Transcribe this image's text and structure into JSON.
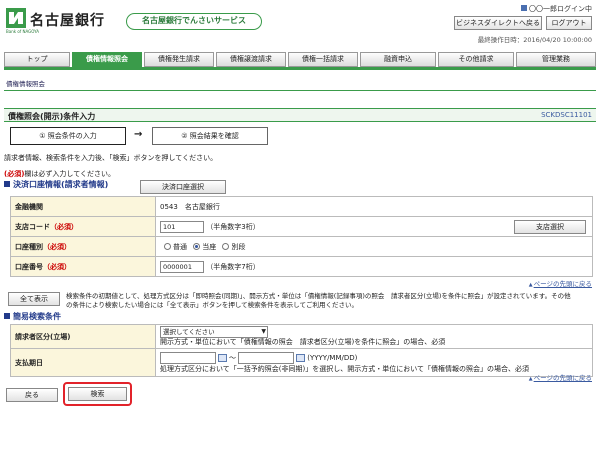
{
  "header": {
    "bank_name": "名古屋銀行",
    "logo_sub": "Bank of NAGOYA",
    "service_name": "名古屋銀行でんさいサービス",
    "user_line": "〇〇一郎ログイン中",
    "direct_button": "ビジネスダイレクトへ戻る",
    "logout_button": "ログアウト",
    "last_operation": "最終操作日時：2016/04/20 10:00:00"
  },
  "tabs": [
    "トップ",
    "債権情報照会",
    "債権発生請求",
    "債権譲渡請求",
    "債権一括請求",
    "融資申込",
    "その他請求",
    "管理業務"
  ],
  "breadcrumb": "債権情報照会",
  "page": {
    "title": "債権照会(開示)条件入力",
    "screen_id": "SCKDSC11101"
  },
  "steps": {
    "step1": "① 照会条件の入力",
    "arrow": "→",
    "step2": "② 照会結果を確認"
  },
  "instruction": "請求者情報、検索条件を入力後、「検索」ボタンを押してください。",
  "required_note_prefix": "(必須)",
  "required_note_text": "欄は必ず入力してください。",
  "settlement": {
    "heading": "決済口座情報(請求者情報)",
    "select_button": "決済口座選択",
    "rows": {
      "bank_label": "金融機関",
      "bank_value": "0543　名古屋銀行",
      "branch_label": "支店コード",
      "branch_req": "（必須）",
      "branch_value": "101",
      "branch_hint": "（半角数字3桁）",
      "branch_button": "支店選択",
      "type_label": "口座種別",
      "type_req": "（必須）",
      "type_options": [
        "普通",
        "当座",
        "別段"
      ],
      "number_label": "口座番号",
      "number_req": "（必須）",
      "number_value": "0000001",
      "number_hint": "（半角数字7桁）"
    }
  },
  "page_top_link": "ページの先頭に戻る",
  "show_all_button": "全て表示",
  "show_all_note": "検索条件の初期値として、処理方式区分は「即時照会(同期)」、開示方式・単位は「債権情報(記録事項)の照会　請求者区分(立場)を条件に照会」が設定されています。その他の条件により検索したい場合には「全て表示」ボタンを押して検索条件を表示してご利用ください。",
  "simple": {
    "heading": "簡易検索条件",
    "role_label": "請求者区分(立場)",
    "role_select": "選択してください",
    "role_note": "開示方式・単位において「債権情報の照会　請求者区分(立場)を条件に照会」の場合、必須",
    "due_label": "支払期日",
    "due_sep": "～",
    "due_format": "(YYYY/MM/DD)",
    "due_note": "処理方式区分において「一括予約照会(非同期)」を選択し、開示方式・単位において「債権情報の照会」の場合、必須"
  },
  "footer": {
    "back_button": "戻る",
    "search_button": "検索"
  },
  "colors": {
    "brand_green": "#3a9b4a",
    "section_blue": "#223a8a",
    "required_red": "#cc0000",
    "highlight_red": "#e2232a"
  }
}
